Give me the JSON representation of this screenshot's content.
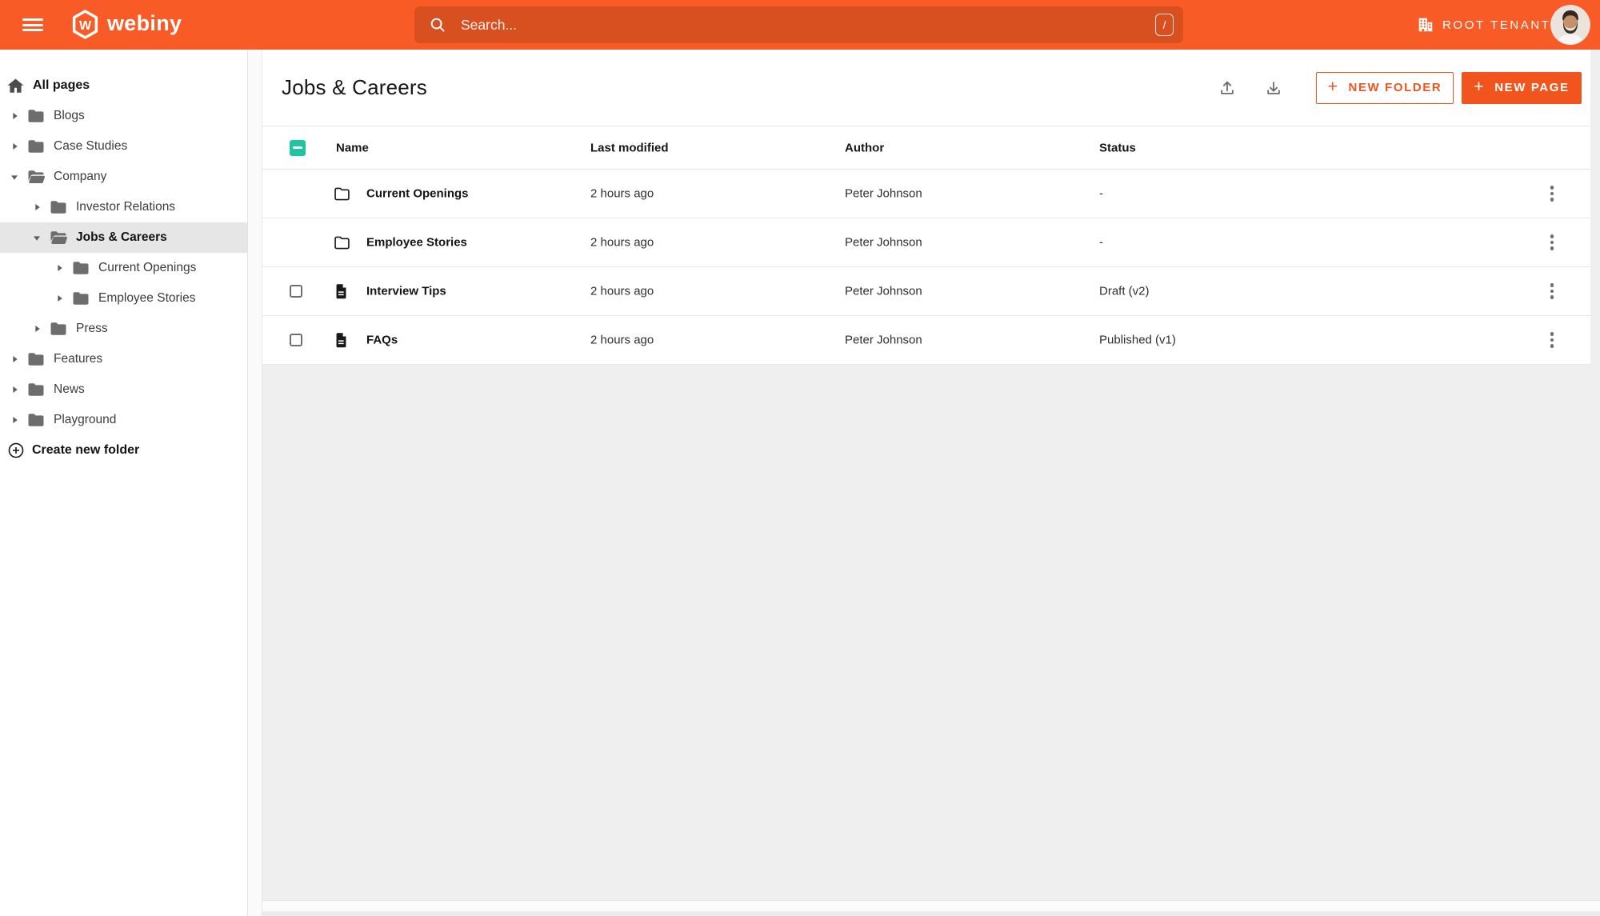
{
  "colors": {
    "brand": "#f85b25",
    "accent": "#f2541d",
    "checkbox_teal": "#20c4a0"
  },
  "header": {
    "logo_text": "webiny",
    "search_placeholder": "Search...",
    "search_shortcut": "/",
    "tenant_label": "ROOT TENANT"
  },
  "sidebar": {
    "root_label": "All pages",
    "create_folder_label": "Create new folder",
    "items": [
      {
        "label": "Blogs",
        "level": 0,
        "expanded": false,
        "selected": false
      },
      {
        "label": "Case Studies",
        "level": 0,
        "expanded": false,
        "selected": false
      },
      {
        "label": "Company",
        "level": 0,
        "expanded": true,
        "selected": false
      },
      {
        "label": "Investor Relations",
        "level": 1,
        "expanded": false,
        "selected": false
      },
      {
        "label": "Jobs & Careers",
        "level": 1,
        "expanded": true,
        "selected": true
      },
      {
        "label": "Current Openings",
        "level": 2,
        "expanded": false,
        "selected": false
      },
      {
        "label": "Employee Stories",
        "level": 2,
        "expanded": false,
        "selected": false
      },
      {
        "label": "Press",
        "level": 1,
        "expanded": false,
        "selected": false
      },
      {
        "label": "Features",
        "level": 0,
        "expanded": false,
        "selected": false
      },
      {
        "label": "News",
        "level": 0,
        "expanded": false,
        "selected": false
      },
      {
        "label": "Playground",
        "level": 0,
        "expanded": false,
        "selected": false
      }
    ]
  },
  "main": {
    "title": "Jobs & Careers",
    "plus": "+",
    "new_folder_label": "NEW FOLDER",
    "new_page_label": "NEW PAGE",
    "table": {
      "columns": [
        "Name",
        "Last modified",
        "Author",
        "Status"
      ],
      "header_checkbox_state": "indeterminate",
      "rows": [
        {
          "type": "folder",
          "name": "Current Openings",
          "last_modified": "2 hours ago",
          "author": "Peter Johnson",
          "status": "-",
          "checkbox": false,
          "checked": false
        },
        {
          "type": "folder",
          "name": "Employee Stories",
          "last_modified": "2 hours ago",
          "author": "Peter Johnson",
          "status": "-",
          "checkbox": false,
          "checked": false
        },
        {
          "type": "page",
          "name": "Interview Tips",
          "last_modified": "2 hours ago",
          "author": "Peter Johnson",
          "status": "Draft (v2)",
          "checkbox": true,
          "checked": false
        },
        {
          "type": "page",
          "name": "FAQs",
          "last_modified": "2 hours ago",
          "author": "Peter Johnson",
          "status": "Published (v1)",
          "checkbox": true,
          "checked": false
        }
      ]
    }
  }
}
